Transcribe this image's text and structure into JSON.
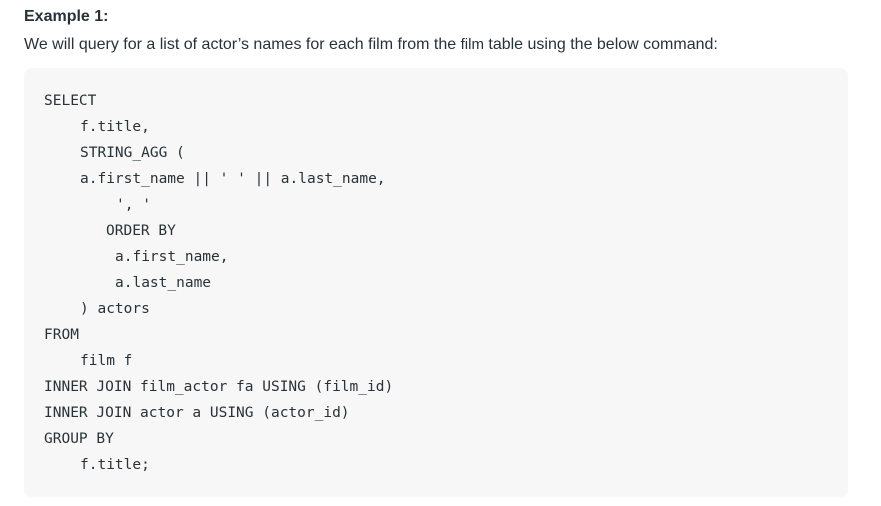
{
  "heading": "Example 1:",
  "intro": {
    "before": "We will query for a list of actor’s names for each film from the ",
    "code": "film",
    "after": " table using the below command:"
  },
  "code": {
    "lines": [
      {
        "text": "SELECT",
        "indent": 0
      },
      {
        "text": "f.title,",
        "indent": 1
      },
      {
        "text": "STRING_AGG (",
        "indent": 1
      },
      {
        "text": "a.first_name || ' ' || a.last_name,",
        "indent": 1
      },
      {
        "text": "', '",
        "indent": 2
      },
      {
        "text": "ORDER BY",
        "indent": 3
      },
      {
        "text": "a.first_name,",
        "indent": 4
      },
      {
        "text": "a.last_name",
        "indent": 4
      },
      {
        "text": ") actors",
        "indent": 1
      },
      {
        "text": "FROM",
        "indent": 0
      },
      {
        "text": "film f",
        "indent": 1
      },
      {
        "text": "INNER JOIN film_actor fa USING (film_id)",
        "indent": 0
      },
      {
        "text": "INNER JOIN actor a USING (actor_id)",
        "indent": 0
      },
      {
        "text": "GROUP BY",
        "indent": 0
      },
      {
        "text": "f.title;",
        "indent": 1
      }
    ]
  }
}
